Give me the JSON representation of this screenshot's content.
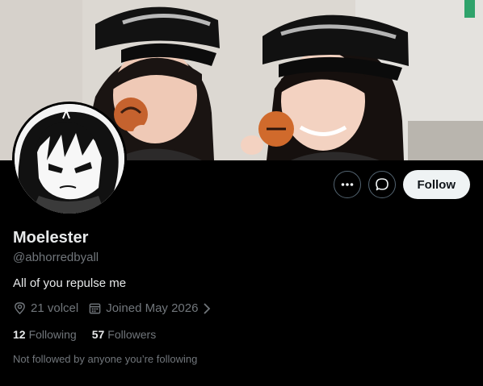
{
  "profile": {
    "display_name": "Moelester",
    "handle": "@abhorredbyall",
    "bio": "All of you repulse me",
    "location": "21 volcel",
    "joined": "Joined May 2026",
    "following_count": "12",
    "following_label": "Following",
    "followers_count": "57",
    "followers_label": "Followers",
    "not_followed_text": "Not followed by anyone you’re following"
  },
  "actions": {
    "follow_label": "Follow",
    "more_icon": "ellipsis-icon",
    "message_icon": "message-bubble-icon"
  },
  "colors": {
    "background": "#000000",
    "primary_text": "#e7e9ea",
    "secondary_text": "#71767b",
    "button_border": "#536471",
    "follow_button_bg": "#eff3f4"
  }
}
